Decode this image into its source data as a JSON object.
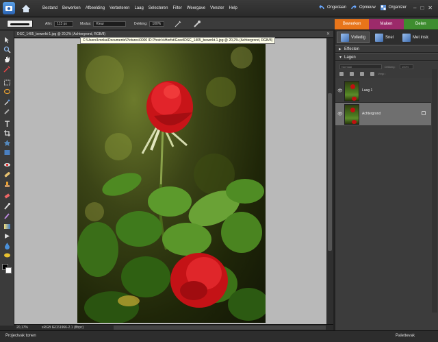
{
  "menu": [
    "Bestand",
    "Bewerken",
    "Afbeelding",
    "Verbeteren",
    "Laag",
    "Selecteren",
    "Filter",
    "Weergave",
    "Venster",
    "Help"
  ],
  "top_right": {
    "undo": "Ongedaan",
    "redo": "Opnieuw",
    "organizer": "Organizer"
  },
  "window_controls": {
    "minimize": "–",
    "maximize": "□",
    "close": "✕"
  },
  "options": {
    "size_label": "Afm:",
    "size_value": "113 px",
    "mode_label": "Modus:",
    "mode_value": "Kleur",
    "opacity_label": "Dekking:",
    "opacity_value": "100%"
  },
  "mode_tabs": [
    {
      "label": "Bewerken",
      "color": "#e8751a"
    },
    {
      "label": "Maken",
      "color": "#9c2a6a"
    },
    {
      "label": "Delen",
      "color": "#3e8d2f"
    }
  ],
  "document": {
    "tab_title": "DSC_1405_bewerkt-1.jpg @ 20,2% (Achtergrond, RGB/8)",
    "close": "✕",
    "tooltip": "C:\\Users\\Ivonka\\Documents\\Pictures\\0000 ID Photo's\\Herfst\\Goed\\DSC_1405_bewerkt-1.jpg @ 20,2% (Achtergrond, RGB/8)"
  },
  "status": {
    "zoom": "20,17%",
    "profile": "sRGB IEC61966-2.1 (8bpc)"
  },
  "panel": {
    "sub_tabs": [
      "Volledig",
      "Snel",
      "Met instr."
    ],
    "effects_label": "Effecten",
    "layers_label": "Lagen",
    "blend_mode": "Normaal",
    "opacity_label": "Dekking:",
    "opacity_value": "100%",
    "lock_label": "Vergr.:",
    "layers": [
      {
        "name": "Laag 1",
        "selected": false
      },
      {
        "name": "Achtergrond",
        "selected": true
      }
    ]
  },
  "bottom": {
    "left": "Projectvak tonen",
    "right": "Palettevak"
  }
}
